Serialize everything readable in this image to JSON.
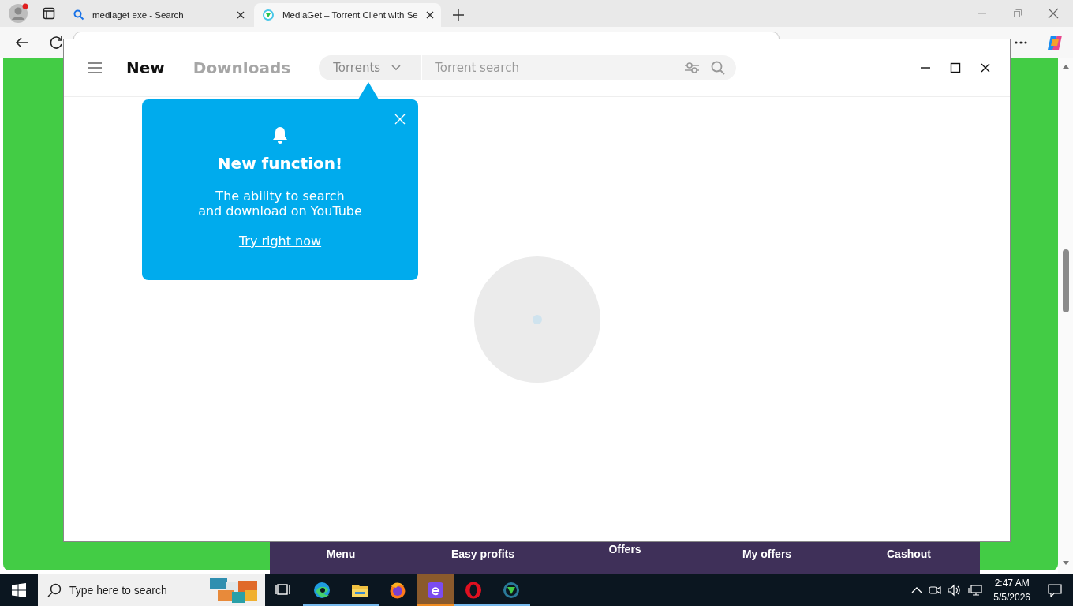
{
  "browser": {
    "tabs": [
      {
        "kind": "search",
        "title": "mediaget exe - Search",
        "selected": false
      },
      {
        "kind": "site",
        "title": "MediaGet – Torrent Client with Se",
        "selected": true
      }
    ]
  },
  "page": {
    "bottom_nav": [
      {
        "label": "Menu",
        "raised": false
      },
      {
        "label": "Easy profits",
        "raised": false
      },
      {
        "label": "Offers",
        "raised": true
      },
      {
        "label": "My offers",
        "raised": false
      },
      {
        "label": "Cashout",
        "raised": false
      }
    ]
  },
  "app": {
    "tabs": [
      {
        "label": "New",
        "selected": true
      },
      {
        "label": "Downloads",
        "selected": false
      }
    ],
    "search": {
      "category": "Torrents",
      "placeholder": "Torrent search"
    },
    "popup": {
      "title": "New function!",
      "message": "The ability to search\nand download on YouTube",
      "link": "Try right now"
    }
  },
  "taskbar": {
    "search_placeholder": "Type here to search",
    "apps": [
      {
        "kind": "taskview",
        "running": false,
        "selected": false
      },
      {
        "kind": "edge",
        "running": true,
        "selected": false
      },
      {
        "kind": "explorer",
        "running": true,
        "selected": false
      },
      {
        "kind": "firefox",
        "running": false,
        "selected": false
      },
      {
        "kind": "calc",
        "running": true,
        "selected": true
      },
      {
        "kind": "opera",
        "running": true,
        "selected": false
      },
      {
        "kind": "mediaget",
        "running": true,
        "selected": false
      }
    ],
    "time": "2:47 AM",
    "date": "5/5/2026"
  }
}
